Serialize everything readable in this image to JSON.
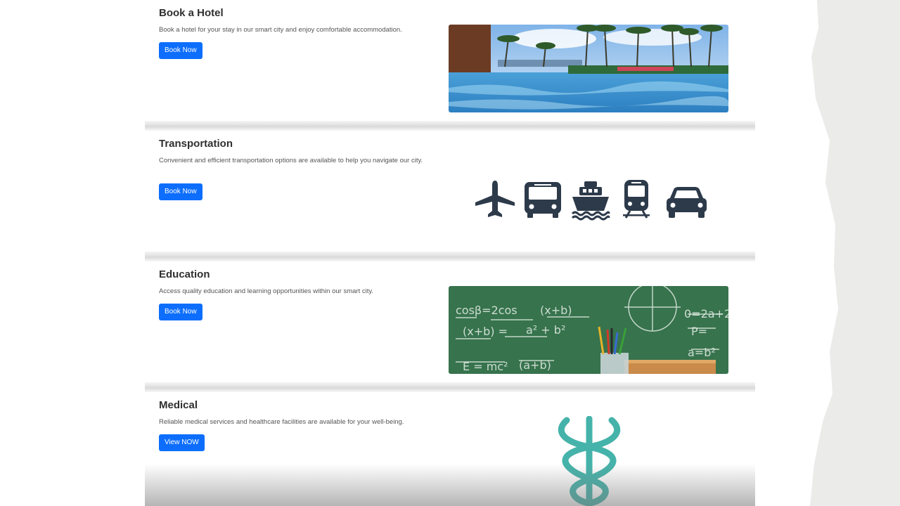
{
  "sections": [
    {
      "title": "Book a Hotel",
      "description": "Book a hotel for your stay in our smart city and enjoy comfortable accommodation.",
      "button": "Book Now",
      "image": "resort-pool-palm-trees-photo"
    },
    {
      "title": "Transportation",
      "description": "Convenient and efficient transportation options are available to help you navigate our city.",
      "button": "Book Now",
      "icons": [
        "airplane-icon",
        "bus-icon",
        "ship-icon",
        "train-icon",
        "car-icon"
      ]
    },
    {
      "title": "Education",
      "description": "Access quality education and learning opportunities within our smart city.",
      "button": "Book Now",
      "image": "chalkboard-with-pencils-photo"
    },
    {
      "title": "Medical",
      "description": "Reliable medical services and healthcare facilities are available for your well-being.",
      "button": "View NOW",
      "image": "caduceus-icon"
    }
  ],
  "colors": {
    "button": "#0d6efd",
    "icon": "#2d3a4a",
    "caduceus": "#45b3aa"
  }
}
